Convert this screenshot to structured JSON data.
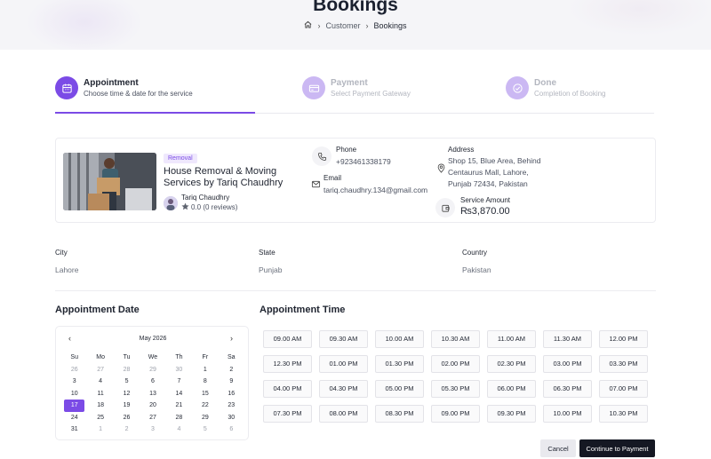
{
  "header": {
    "title": "Bookings",
    "breadcrumb": [
      "Customer",
      "Bookings"
    ]
  },
  "steps": [
    {
      "title": "Appointment",
      "subtitle": "Choose time & date for the service",
      "icon": "calendar-icon",
      "state": "active"
    },
    {
      "title": "Payment",
      "subtitle": "Select Payment Gateway",
      "icon": "card-icon",
      "state": "inactive"
    },
    {
      "title": "Done",
      "subtitle": "Completion of Booking",
      "icon": "check-icon",
      "state": "inactive"
    }
  ],
  "service": {
    "badge": "Removal",
    "title": "House Removal & Moving Services by Tariq Chaudhry",
    "provider_name": "Tariq Chaudhry",
    "rating": "0.0 (0 reviews)",
    "phone_label": "Phone",
    "phone": "+923461338179",
    "email_label": "Email",
    "email": "tariq.chaudhry.134@gmail.com",
    "address_label": "Address",
    "address_lines": [
      "Shop 15, Blue Area, Behind",
      "Centaurus Mall, Lahore,",
      "Punjab 72434, Pakistan"
    ],
    "amount_label": "Service Amount",
    "amount": "₨3,870.00"
  },
  "location": {
    "city_label": "City",
    "city": "Lahore",
    "state_label": "State",
    "state": "Punjab",
    "country_label": "Country",
    "country": "Pakistan"
  },
  "appointment_date": {
    "title": "Appointment Date",
    "month": "May 2026",
    "prev": "‹",
    "next": "›",
    "weekdays": [
      "Su",
      "Mo",
      "Tu",
      "We",
      "Th",
      "Fr",
      "Sa"
    ],
    "weeks": [
      [
        "26",
        "27",
        "28",
        "29",
        "30",
        "1",
        "2"
      ],
      [
        "3",
        "4",
        "5",
        "6",
        "7",
        "8",
        "9"
      ],
      [
        "10",
        "11",
        "12",
        "13",
        "14",
        "15",
        "16"
      ],
      [
        "17",
        "18",
        "19",
        "20",
        "21",
        "22",
        "23"
      ],
      [
        "24",
        "25",
        "26",
        "27",
        "28",
        "29",
        "30"
      ],
      [
        "31",
        "1",
        "2",
        "3",
        "4",
        "5",
        "6"
      ]
    ],
    "selected": "17"
  },
  "appointment_time": {
    "title": "Appointment Time",
    "slots": [
      "09.00 AM",
      "09.30 AM",
      "10.00 AM",
      "10.30 AM",
      "11.00 AM",
      "11.30 AM",
      "12.00 PM",
      "12.30 PM",
      "01.00 PM",
      "01.30 PM",
      "02.00 PM",
      "02.30 PM",
      "03.00 PM",
      "03.30 PM",
      "04.00 PM",
      "04.30 PM",
      "05.00 PM",
      "05.30 PM",
      "06.00 PM",
      "06.30 PM",
      "07.00 PM",
      "07.30 PM",
      "08.00 PM",
      "08.30 PM",
      "09.00 PM",
      "09.30 PM",
      "10.00 PM",
      "10.30 PM"
    ]
  },
  "actions": {
    "cancel": "Cancel",
    "continue": "Continue to Payment"
  },
  "colors": {
    "accent": "#7b4be6",
    "accent_light": "#cbb8f3",
    "primary_button": "#151823"
  }
}
